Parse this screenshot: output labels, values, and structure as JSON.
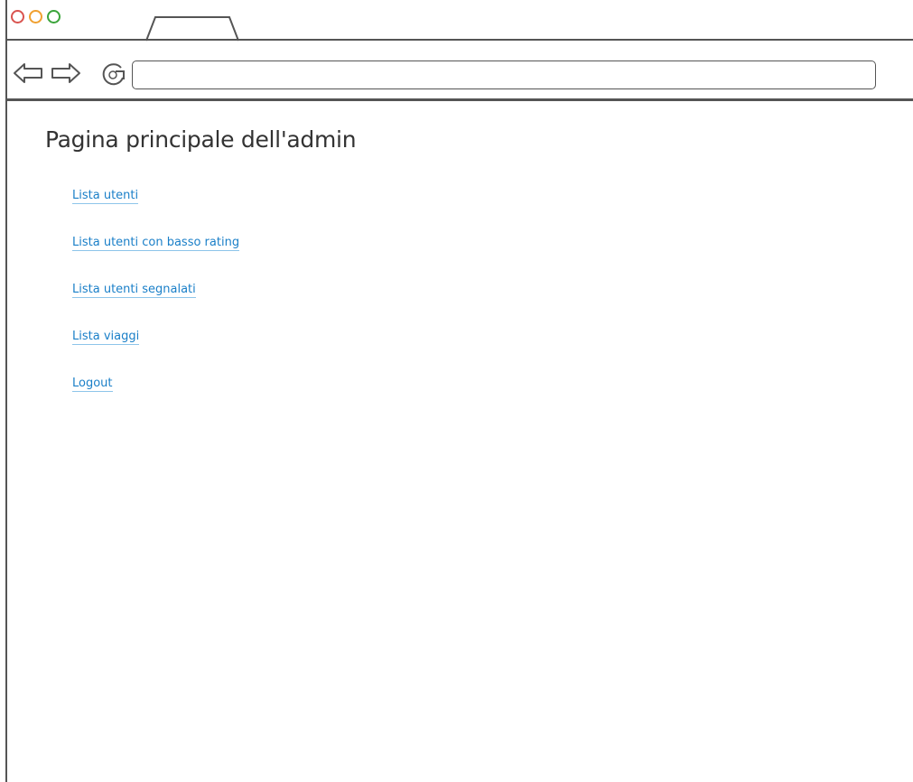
{
  "window": {
    "traffic_lights": [
      {
        "name": "close",
        "color": "#d9534f"
      },
      {
        "name": "minimize",
        "color": "#f0a030"
      },
      {
        "name": "maximize",
        "color": "#3aa43a"
      }
    ]
  },
  "toolbar": {
    "back_icon": "back-arrow-icon",
    "forward_icon": "forward-arrow-icon",
    "reload_icon": "reload-icon",
    "address_value": ""
  },
  "page": {
    "title": "Pagina principale dell'admin",
    "links": [
      {
        "label": "Lista utenti"
      },
      {
        "label": "Lista utenti con basso rating"
      },
      {
        "label": "Lista utenti segnalati"
      },
      {
        "label": "Lista viaggi"
      },
      {
        "label": "Logout"
      }
    ]
  },
  "colors": {
    "link": "#1a7fc8",
    "link_underline": "#8ec5ea",
    "chrome_lines": "#555555"
  }
}
